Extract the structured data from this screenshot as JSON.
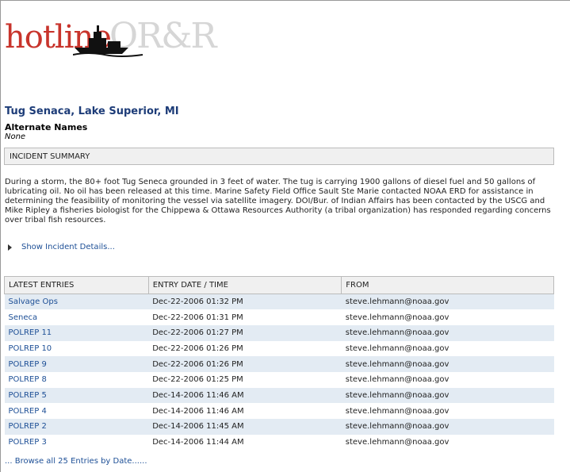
{
  "logo": {
    "text_hot": "hotline",
    "text_orr": "OR&R"
  },
  "incident": {
    "title": "Tug Senaca, Lake Superior, MI",
    "alternate_names_label": "Alternate Names",
    "alternate_names_value": "None"
  },
  "summary": {
    "header": "INCIDENT SUMMARY",
    "text": "During a storm, the 80+ foot Tug Seneca grounded in 3 feet of water. The tug is carrying 1900 gallons of diesel fuel and 50 gallons of lubricating oil. No oil has been released at this time. Marine Safety Field Office Sault Ste Marie contacted NOAA ERD for assistance in determining the feasibility of monitoring the vessel via satellite imagery. DOI/Bur. of Indian Affairs has been contacted by the USCG and Mike Ripley a fisheries biologist for the Chippewa & Ottawa Resources Authority (a tribal organization) has responded regarding concerns over tribal fish resources.",
    "show_details": "Show Incident Details..."
  },
  "entries": {
    "headers": [
      "LATEST ENTRIES",
      "ENTRY DATE / TIME",
      "FROM"
    ],
    "rows": [
      {
        "title": "Salvage Ops",
        "date": "Dec-22-2006 01:32 PM",
        "from": "steve.lehmann@noaa.gov"
      },
      {
        "title": "Seneca",
        "date": "Dec-22-2006 01:31 PM",
        "from": "steve.lehmann@noaa.gov"
      },
      {
        "title": "POLREP 11",
        "date": "Dec-22-2006 01:27 PM",
        "from": "steve.lehmann@noaa.gov"
      },
      {
        "title": "POLREP 10",
        "date": "Dec-22-2006 01:26 PM",
        "from": "steve.lehmann@noaa.gov"
      },
      {
        "title": "POLREP 9",
        "date": "Dec-22-2006 01:26 PM",
        "from": "steve.lehmann@noaa.gov"
      },
      {
        "title": "POLREP 8",
        "date": "Dec-22-2006 01:25 PM",
        "from": "steve.lehmann@noaa.gov"
      },
      {
        "title": "POLREP 5",
        "date": "Dec-14-2006 11:46 AM",
        "from": "steve.lehmann@noaa.gov"
      },
      {
        "title": "POLREP 4",
        "date": "Dec-14-2006 11:46 AM",
        "from": "steve.lehmann@noaa.gov"
      },
      {
        "title": "POLREP 2",
        "date": "Dec-14-2006 11:45 AM",
        "from": "steve.lehmann@noaa.gov"
      },
      {
        "title": "POLREP 3",
        "date": "Dec-14-2006 11:44 AM",
        "from": "steve.lehmann@noaa.gov"
      }
    ],
    "browse_all": "... Browse all 25 Entries by Date......"
  }
}
